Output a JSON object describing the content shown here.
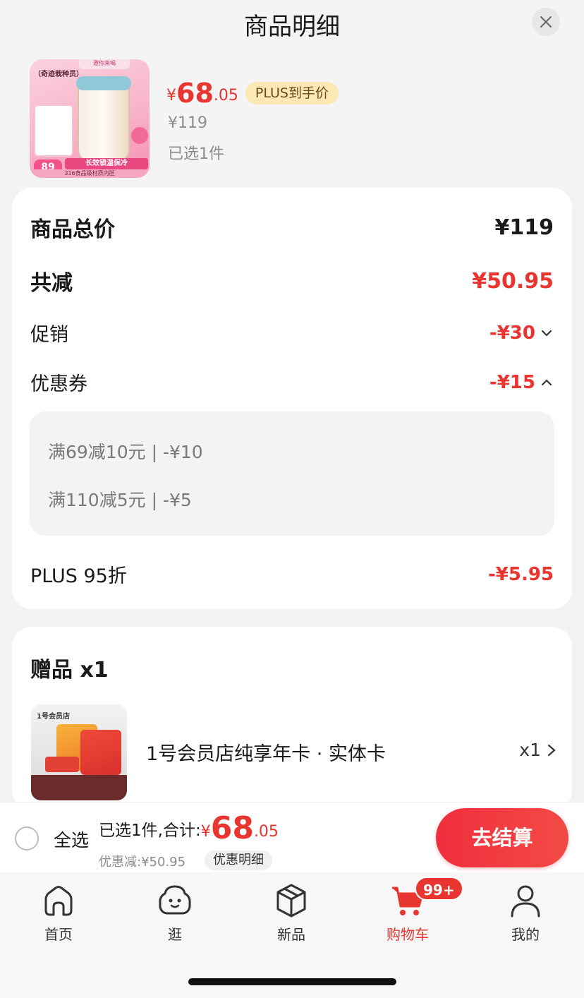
{
  "header": {
    "title": "商品明细"
  },
  "product": {
    "price_currency": "¥",
    "price_integer": "68",
    "price_decimal": ".05",
    "plus_badge": "PLUS到手价",
    "original_price": "¥119",
    "selected_count": "已选1件",
    "thumbnail": {
      "brand": "（奇迹栽种员）",
      "tag": "邀你来喝",
      "price": "89",
      "band": "长效锁温保冷",
      "footer": "316食品级材质内胆"
    }
  },
  "summary": {
    "total_label": "商品总价",
    "total_value": "¥119",
    "reduce_label": "共减",
    "reduce_value": "¥50.95",
    "promo_label": "促销",
    "promo_value": "-¥30",
    "coupon_label": "优惠券",
    "coupon_value": "-¥15",
    "coupons": [
      "满69减10元 | -¥10",
      "满110减5元 | -¥5"
    ],
    "plus_label": "PLUS 95折",
    "plus_value": "-¥5.95"
  },
  "gift": {
    "title": "赠品 x1",
    "name": "1号会员店纯享年卡 · 实体卡",
    "qty": "x1",
    "thumbnail_logo": "1号会员店"
  },
  "checkout": {
    "select_all": "全选",
    "total_prefix": "已选1件,合计:",
    "total_currency": "¥",
    "total_integer": "68",
    "total_decimal": ".05",
    "discount_text": "优惠减:¥50.95",
    "detail_button": "优惠明细",
    "checkout_button": "去结算"
  },
  "tabs": [
    {
      "label": "首页",
      "icon": "home-icon"
    },
    {
      "label": "逛",
      "icon": "explore-icon"
    },
    {
      "label": "新品",
      "icon": "new-icon"
    },
    {
      "label": "购物车",
      "icon": "cart-icon",
      "active": true,
      "badge": "99+"
    },
    {
      "label": "我的",
      "icon": "profile-icon"
    }
  ],
  "colors": {
    "accent": "#e8352f",
    "plus_badge_bg": "#fbe8b4"
  }
}
